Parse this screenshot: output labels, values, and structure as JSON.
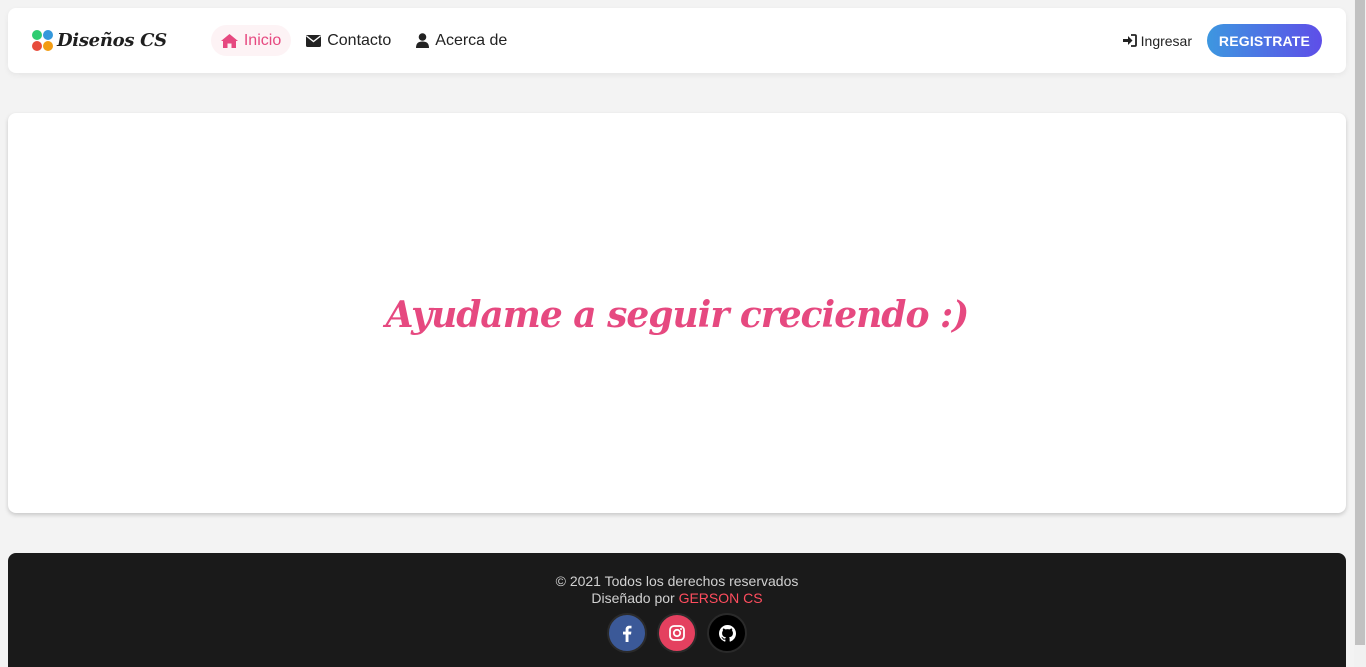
{
  "brand": {
    "name": "Diseños CS",
    "dot_colors": [
      "#2ecc71",
      "#e74c3c",
      "#3498db",
      "#f39c12"
    ]
  },
  "nav": {
    "items": [
      {
        "label": "Inicio",
        "icon": "home-icon",
        "active": true
      },
      {
        "label": "Contacto",
        "icon": "envelope-icon",
        "active": false
      },
      {
        "label": "Acerca de",
        "icon": "user-icon",
        "active": false
      }
    ],
    "login_label": "Ingresar",
    "register_label": "REGISTRATE"
  },
  "hero": {
    "text": "Ayudame a seguir creciendo :)"
  },
  "footer": {
    "copyright": "© 2021 Todos los derechos reservados",
    "designed_by": "Diseñado por",
    "author": "GERSON CS",
    "socials": [
      "facebook-icon",
      "instagram-icon",
      "github-icon"
    ]
  },
  "colors": {
    "accent": "#e64980",
    "register_start": "#3d97e0",
    "register_end": "#5e4ee8",
    "footer_bg": "#1a1a1a"
  }
}
